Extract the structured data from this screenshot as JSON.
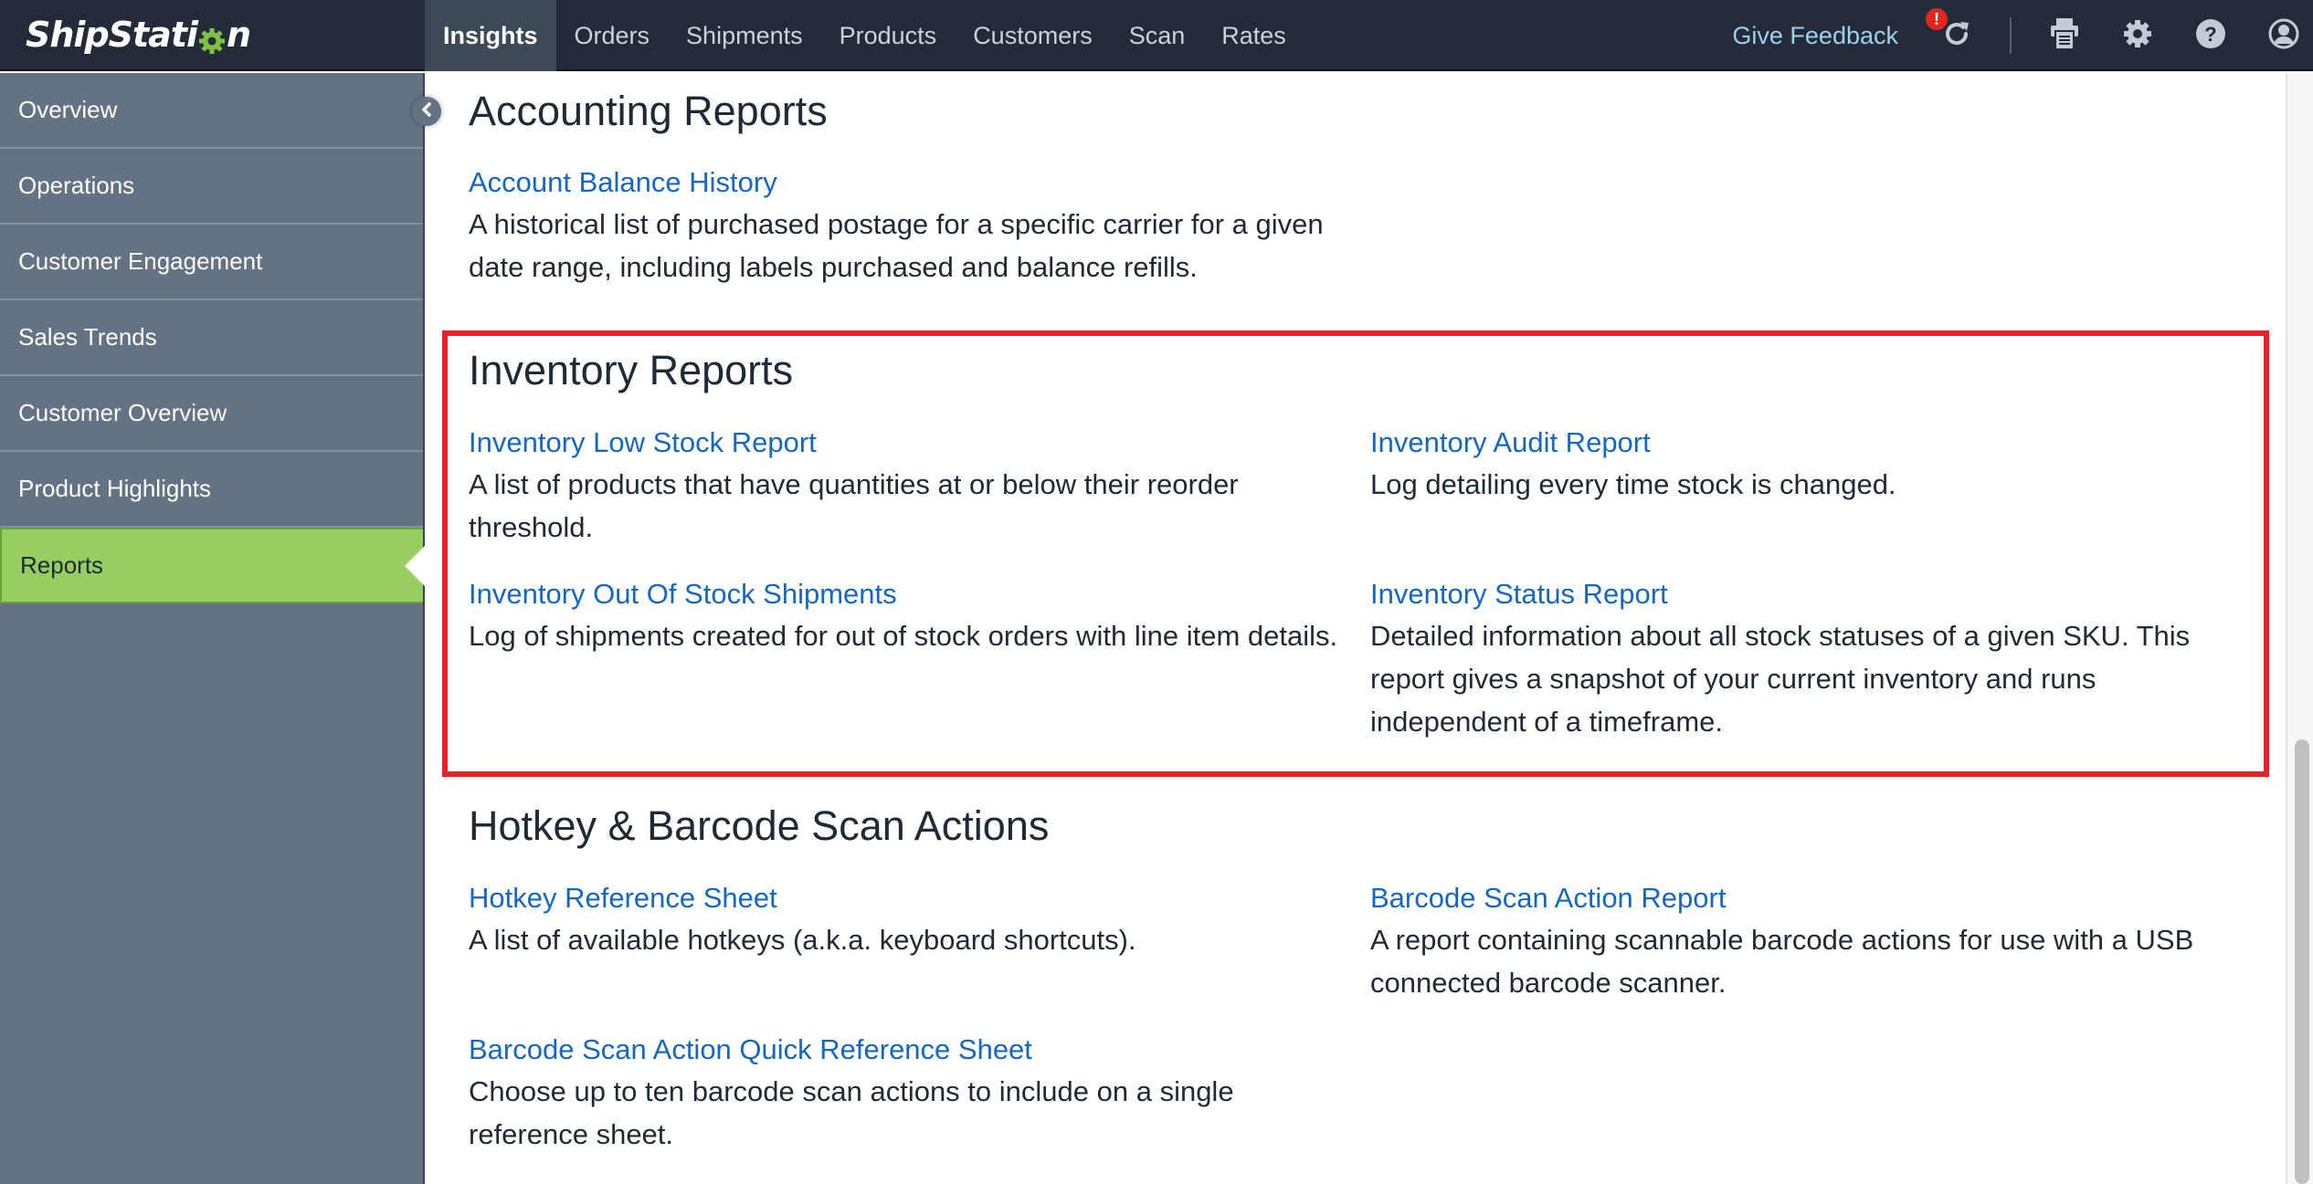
{
  "app": {
    "logo_text_pre": "ShipStati",
    "logo_text_post": "n",
    "brand_green": "#7dc243"
  },
  "nav": {
    "tabs": [
      {
        "label": "Insights",
        "active": true
      },
      {
        "label": "Orders",
        "active": false
      },
      {
        "label": "Shipments",
        "active": false
      },
      {
        "label": "Products",
        "active": false
      },
      {
        "label": "Customers",
        "active": false
      },
      {
        "label": "Scan",
        "active": false
      },
      {
        "label": "Rates",
        "active": false
      }
    ],
    "feedback_label": "Give Feedback",
    "alert_badge": "!",
    "icons": [
      "refresh-icon",
      "printer-icon",
      "gear-icon",
      "help-icon",
      "user-icon"
    ]
  },
  "sidebar": {
    "items": [
      {
        "label": "Overview",
        "active": false
      },
      {
        "label": "Operations",
        "active": false
      },
      {
        "label": "Customer Engagement",
        "active": false
      },
      {
        "label": "Sales Trends",
        "active": false
      },
      {
        "label": "Customer Overview",
        "active": false
      },
      {
        "label": "Product Highlights",
        "active": false
      },
      {
        "label": "Reports",
        "active": true
      }
    ],
    "collapse_icon": "chevron-left-icon"
  },
  "content": {
    "sections": [
      {
        "title": "Accounting Reports",
        "reports": [
          {
            "link": "Account Balance History",
            "desc": "A historical list of purchased postage for a specific carrier for a given date range, including labels purchased and balance refills."
          }
        ]
      },
      {
        "title": "Inventory Reports",
        "highlighted": true,
        "highlight_color": "#e8202a",
        "reports": [
          {
            "link": "Inventory Low Stock Report",
            "desc": "A list of products that have quantities at or below their reorder threshold."
          },
          {
            "link": "Inventory Audit Report",
            "desc": "Log detailing every time stock is changed."
          },
          {
            "link": "Inventory Out Of Stock Shipments",
            "desc": "Log of shipments created for out of stock orders with line item details."
          },
          {
            "link": "Inventory Status Report",
            "desc": "Detailed information about all stock statuses of a given SKU. This report gives a snapshot of your current inventory and runs independent of a timeframe."
          }
        ]
      },
      {
        "title": "Hotkey & Barcode Scan Actions",
        "reports": [
          {
            "link": "Hotkey Reference Sheet",
            "desc": "A list of available hotkeys (a.k.a. keyboard shortcuts)."
          },
          {
            "link": "Barcode Scan Action Report",
            "desc": "A report containing scannable barcode actions for use with a USB connected barcode scanner."
          },
          {
            "link": "Barcode Scan Action Quick Reference Sheet",
            "desc": "Choose up to ten barcode scan actions to include on a single reference sheet."
          }
        ]
      }
    ]
  },
  "colors": {
    "topbar": "#222b37",
    "sidebar": "#637383",
    "active_sidebar": "#97ce62",
    "link": "#1567c0",
    "text": "#1e2a36"
  }
}
